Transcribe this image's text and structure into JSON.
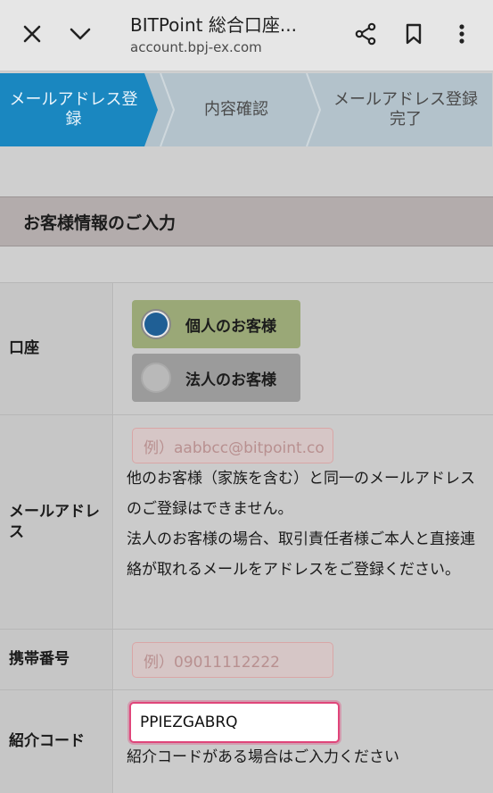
{
  "browser": {
    "title": "BITPoint 総合口座...",
    "url": "account.bpj-ex.com",
    "icons": {
      "close": "close-icon",
      "expand": "chevron-down-icon",
      "share": "share-icon",
      "bookmark": "bookmark-icon",
      "menu": "more-vert-icon"
    }
  },
  "steps": [
    {
      "label": "メールアドレス登録",
      "active": true
    },
    {
      "label": "内容確認",
      "active": false
    },
    {
      "label": "メールアドレス登録完了",
      "active": false
    }
  ],
  "section_title": "お客様情報のご入力",
  "form": {
    "account": {
      "label": "口座",
      "options": [
        {
          "label": "個人のお客様",
          "selected": true
        },
        {
          "label": "法人のお客様",
          "selected": false
        }
      ]
    },
    "email": {
      "label": "メールアドレス",
      "placeholder": "例）aabbcc@bitpoint.co",
      "notes": [
        "他のお客様（家族を含む）と同一のメールアドレスのご登録はできません。",
        "法人のお客様の場合、取引責任者様ご本人と直接連絡が取れるメールをアドレスをご登録ください。"
      ]
    },
    "phone": {
      "label": "携帯番号",
      "placeholder": "例）09011112222"
    },
    "referral": {
      "label": "紹介コード",
      "value": "PPIEZGABRQ",
      "note": "紹介コードがある場合はご入力ください"
    }
  },
  "colors": {
    "step_active": "#1a87c0",
    "step_inactive": "#b3c2cb",
    "radio_selected_bg": "#9aa877",
    "radio_selected_dot": "#1f5f95",
    "referral_border": "#e0457a"
  }
}
